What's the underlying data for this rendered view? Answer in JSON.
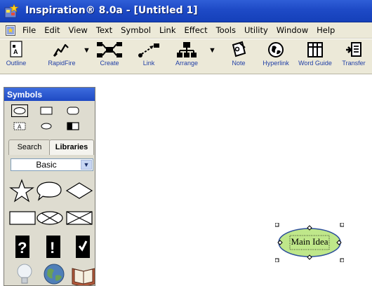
{
  "window": {
    "title": "Inspiration® 8.0a - [Untitled 1]"
  },
  "menu": {
    "items": [
      "File",
      "Edit",
      "View",
      "Text",
      "Symbol",
      "Link",
      "Effect",
      "Tools",
      "Utility",
      "Window",
      "Help"
    ]
  },
  "toolbar": {
    "tools": [
      "Outline",
      "RapidFire",
      "Create",
      "Link",
      "Arrange",
      "Note",
      "Hyperlink",
      "Word Guide",
      "Transfer"
    ]
  },
  "symbols_palette": {
    "title": "Symbols",
    "tabs": [
      "Search",
      "Libraries"
    ],
    "active_tab": "Libraries",
    "library": "Basic"
  },
  "diagram": {
    "node_label": "Main Idea",
    "node_color": "#bfe78a"
  },
  "colors": {
    "title_bar": "#1e4ac6",
    "chrome": "#ece9d8",
    "tool_label": "#1f3ea6"
  }
}
